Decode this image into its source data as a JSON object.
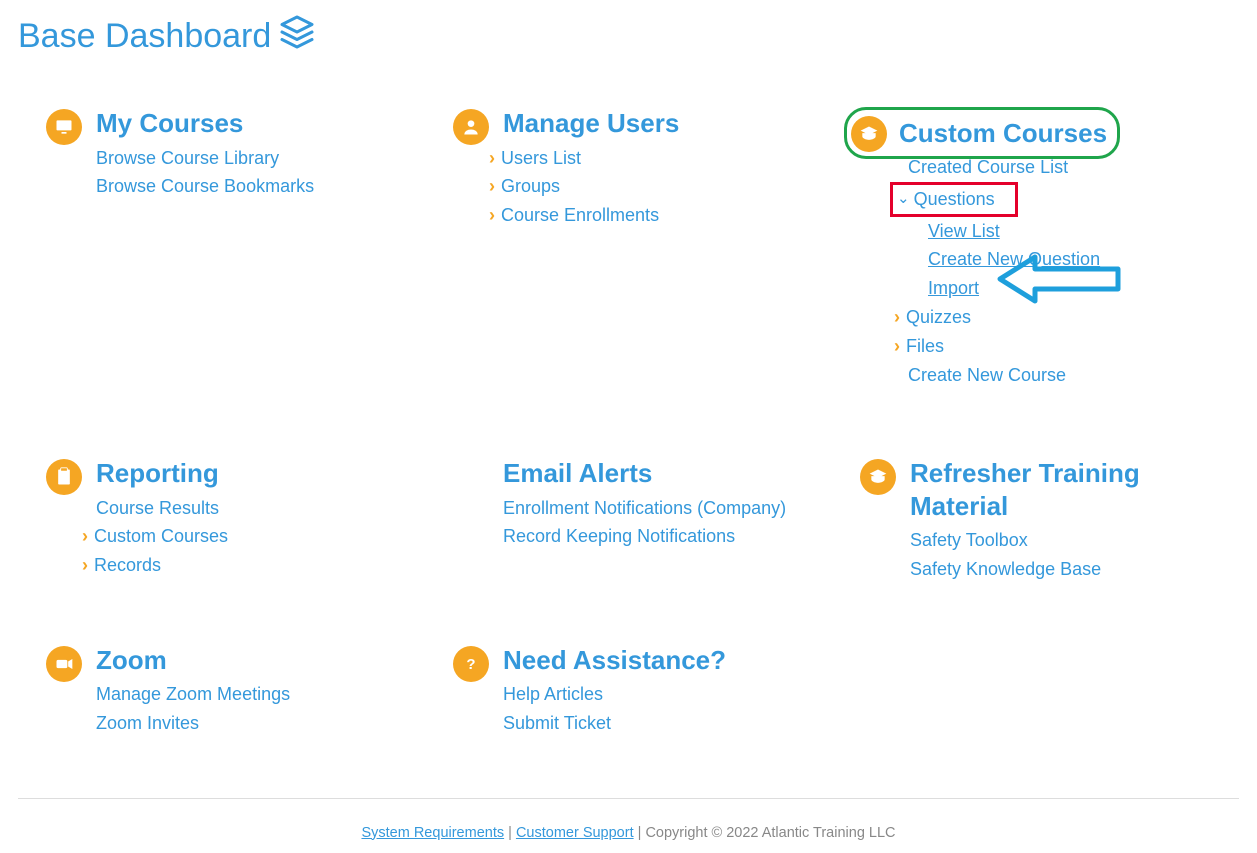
{
  "title": "Base Dashboard",
  "sections": {
    "my_courses": {
      "title": "My Courses",
      "links": {
        "browse_library": "Browse Course Library",
        "browse_bookmarks": "Browse Course Bookmarks"
      }
    },
    "manage_users": {
      "title": "Manage Users",
      "links": {
        "users_list": "Users List",
        "groups": "Groups",
        "course_enrollments": "Course Enrollments"
      }
    },
    "custom_courses": {
      "title": "Custom Courses",
      "links": {
        "created_list": "Created Course List",
        "questions": "Questions",
        "questions_sub": {
          "view_list": "View List",
          "create_new": "Create New Question",
          "import": "Import"
        },
        "quizzes": "Quizzes",
        "files": "Files",
        "create_new_course": "Create New Course"
      }
    },
    "reporting": {
      "title": "Reporting",
      "links": {
        "course_results": "Course Results",
        "custom_courses": "Custom Courses",
        "records": "Records"
      }
    },
    "email_alerts": {
      "title": "Email Alerts",
      "links": {
        "enroll_notif": "Enrollment Notifications (Company)",
        "record_keeping": "Record Keeping Notifications"
      }
    },
    "refresher": {
      "title": "Refresher Training Material",
      "links": {
        "safety_toolbox": "Safety Toolbox",
        "safety_kb": "Safety Knowledge Base"
      }
    },
    "zoom": {
      "title": "Zoom",
      "links": {
        "manage_meetings": "Manage Zoom Meetings",
        "invites": "Zoom Invites"
      }
    },
    "need_assistance": {
      "title": "Need Assistance?",
      "links": {
        "help_articles": "Help Articles",
        "submit_ticket": "Submit Ticket"
      }
    }
  },
  "footer": {
    "sys_req": "System Requirements",
    "support": "Customer Support",
    "copyright": "Copyright © 2022 Atlantic Training LLC"
  }
}
